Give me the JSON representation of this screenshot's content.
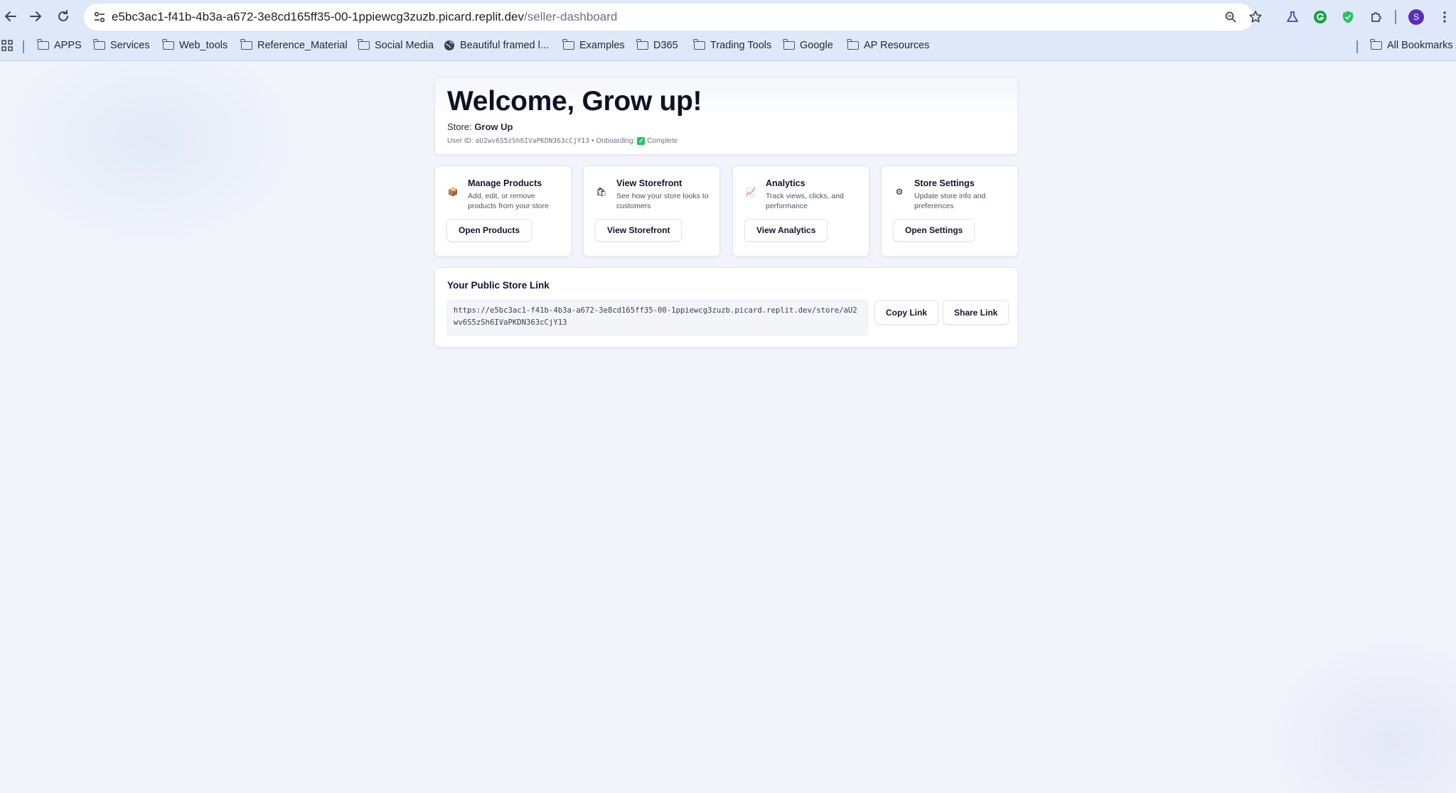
{
  "browser": {
    "url_host": "e5bc3ac1-f41b-4b3a-a672-3e8cd165ff35-00-1ppiewcg3zuzb.picard.replit.dev",
    "url_path": "/seller-dashboard",
    "profile_initial": "S",
    "bookmarks": [
      {
        "label": "APPS",
        "icon": "folder-icon"
      },
      {
        "label": "Services",
        "icon": "folder-icon"
      },
      {
        "label": "Web_tools",
        "icon": "folder-icon"
      },
      {
        "label": "Reference_Material",
        "icon": "folder-icon"
      },
      {
        "label": "Social Media",
        "icon": "folder-icon"
      },
      {
        "label": "Beautiful framed l...",
        "icon": "globe-icon"
      },
      {
        "label": "Examples",
        "icon": "folder-icon"
      },
      {
        "label": "D365",
        "icon": "folder-icon"
      },
      {
        "label": "Trading Tools",
        "icon": "folder-icon"
      },
      {
        "label": "Google",
        "icon": "folder-icon"
      },
      {
        "label": "AP Resources",
        "icon": "folder-icon"
      }
    ],
    "all_bookmarks": "All Bookmarks"
  },
  "welcome": {
    "title": "Welcome, Grow up!",
    "store_prefix": "Store:",
    "store_name": "Grow Up",
    "user_id_label": "User ID:",
    "user_id": "aU2wv6S5zSh6IVaPKDN363cCjY13",
    "separator": "•",
    "onboarding_label": "Onboarding:",
    "onboarding_mark": "✓",
    "onboarding_status": "Complete"
  },
  "actions": [
    {
      "icon": "package-icon",
      "glyph": "📦",
      "title": "Manage Products",
      "desc": "Add, edit, or remove products from your store",
      "button": "Open Products"
    },
    {
      "icon": "shopping-bags-icon",
      "glyph": "🛍",
      "title": "View Storefront",
      "desc": "See how your store looks to customers",
      "button": "View Storefront"
    },
    {
      "icon": "chart-icon",
      "glyph": "📈",
      "title": "Analytics",
      "desc": "Track views, clicks, and performance",
      "button": "View Analytics"
    },
    {
      "icon": "gear-icon",
      "glyph": "⚙",
      "title": "Store Settings",
      "desc": "Update store info and preferences",
      "button": "Open Settings"
    }
  ],
  "store_link": {
    "title": "Your Public Store Link",
    "url": "https://e5bc3ac1-f41b-4b3a-a672-3e8cd165ff35-00-1ppiewcg3zuzb.picard.replit.dev/store/aU2wv6S5zSh6IVaPKDN363cCjY13",
    "copy_button": "Copy Link",
    "share_button": "Share Link"
  },
  "colors": {
    "chrome_bg": "#dfe8f8",
    "page_bg": "#f1f4fb",
    "text_primary": "#0f172a",
    "profile_avatar": "#5b2fb5",
    "success": "#22c55e"
  }
}
